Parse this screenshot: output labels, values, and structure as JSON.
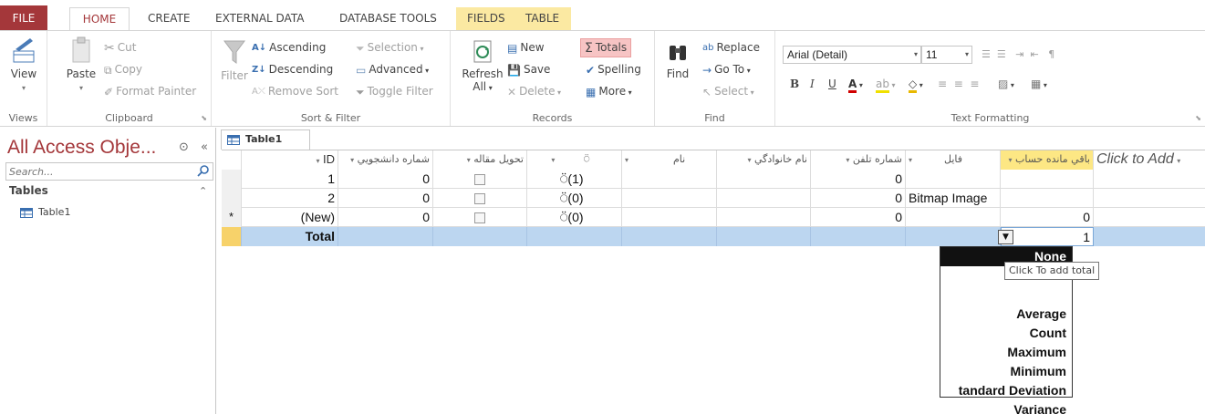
{
  "tabs": {
    "file": "FILE",
    "home": "HOME",
    "create": "CREATE",
    "external_data": "EXTERNAL DATA",
    "database_tools": "DATABASE TOOLS",
    "fields": "FIELDS",
    "table": "TABLE"
  },
  "ribbon": {
    "views": {
      "view": "View",
      "label": "Views"
    },
    "clipboard": {
      "paste": "Paste",
      "cut": "Cut",
      "copy": "Copy",
      "format_painter": "Format Painter",
      "label": "Clipboard"
    },
    "sort_filter": {
      "filter": "Filter",
      "ascending": "Ascending",
      "descending": "Descending",
      "remove_sort": "Remove Sort",
      "selection": "Selection",
      "advanced": "Advanced",
      "toggle_filter": "Toggle Filter",
      "label": "Sort & Filter"
    },
    "records": {
      "refresh": "Refresh",
      "refresh_sub": "All",
      "new": "New",
      "save": "Save",
      "delete": "Delete",
      "totals": "Totals",
      "spelling": "Spelling",
      "more": "More",
      "label": "Records"
    },
    "find": {
      "find": "Find",
      "replace": "Replace",
      "goto": "Go To",
      "select": "Select",
      "label": "Find"
    },
    "text_formatting": {
      "font": "Arial (Detail)",
      "size": "11",
      "bold": "B",
      "italic": "I",
      "underline": "U",
      "label": "Text Formatting"
    }
  },
  "nav": {
    "title": "All Access Obje...",
    "search_placeholder": "Search...",
    "category": "Tables",
    "items": [
      "Table1"
    ]
  },
  "document": {
    "tab": "Table1",
    "columns": [
      "ID",
      "شماره دانشجويي",
      "تحويل مقاله",
      "",
      "نام",
      "نام خانوادگي",
      "شماره تلفن",
      "فايل",
      "باقي مانده حساب",
      "Click to Add"
    ],
    "rows": [
      {
        "id": "1",
        "student_no": "0",
        "attach": "(1)",
        "phone": "0",
        "file": "",
        "balance": ""
      },
      {
        "id": "2",
        "student_no": "0",
        "attach": "(0)",
        "phone": "0",
        "file": "Bitmap Image",
        "balance": ""
      },
      {
        "id": "(New)",
        "student_no": "0",
        "attach": "(0)",
        "phone": "0",
        "file": "",
        "balance": "0"
      }
    ],
    "new_row_marker": "*",
    "total_label": "Total",
    "total_value": "1"
  },
  "totals_dropdown": {
    "options": [
      "None",
      "",
      "",
      "Average",
      "Count",
      "Maximum",
      "Minimum",
      "tandard Deviation",
      "Variance"
    ],
    "selected": "None",
    "tooltip": "Click To add total"
  },
  "colors": {
    "access_red": "#a4373a",
    "contextual_tab": "#fbe9a2",
    "total_row": "#bcd6f0",
    "totals_highlight": "#f7c4c4"
  }
}
